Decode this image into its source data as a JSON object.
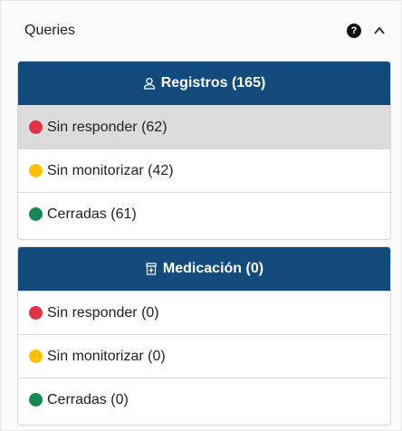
{
  "panel": {
    "title": "Queries",
    "help_icon_glyph": "?",
    "icons": {
      "help": "question-circle-icon",
      "collapse": "chevron-up-icon"
    }
  },
  "cards": [
    {
      "icon": "person-icon",
      "header": "Registros (165)",
      "rows": [
        {
          "status": "red",
          "label": "Sin responder (62)",
          "selected": true
        },
        {
          "status": "yellow",
          "label": "Sin monitorizar (42)",
          "selected": false
        },
        {
          "status": "green",
          "label": "Cerradas (61)",
          "selected": false
        }
      ]
    },
    {
      "icon": "medication-icon",
      "header": "Medicación (0)",
      "rows": [
        {
          "status": "red",
          "label": "Sin responder (0)",
          "selected": false
        },
        {
          "status": "yellow",
          "label": "Sin monitorizar (0)",
          "selected": false
        },
        {
          "status": "green",
          "label": "Cerradas (0)",
          "selected": false
        }
      ]
    }
  ],
  "colors": {
    "header_bg": "#134a7c",
    "red": "#dc3545",
    "yellow": "#ffc107",
    "green": "#198754",
    "selected_bg": "#dcdcdc"
  }
}
